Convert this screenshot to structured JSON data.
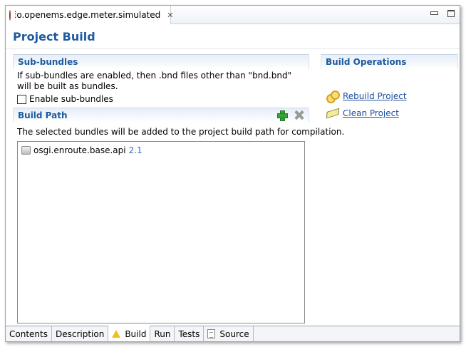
{
  "editor_tab": {
    "title": "io.openems.edge.meter.simulated",
    "close": "✕"
  },
  "form": {
    "title": "Project Build"
  },
  "sub_bundles": {
    "header": "Sub-bundles",
    "description": "If sub-bundles are enabled, then .bnd files other than \"bnd.bnd\" will be built as bundles.",
    "checkbox_label": "Enable sub-bundles",
    "checked": false
  },
  "build_path": {
    "header": "Build Path",
    "description": "The selected bundles will be added to the project build path for compilation.",
    "items": [
      {
        "name": "osgi.enroute.base.api",
        "version": "2.1"
      }
    ]
  },
  "build_operations": {
    "header": "Build Operations",
    "rebuild_label": "Rebuild Project",
    "clean_label": "Clean Project"
  },
  "bottom_tabs": [
    "Contents",
    "Description",
    "Build",
    "Run",
    "Tests",
    "Source"
  ],
  "active_tab": "Build",
  "colors": {
    "accent": "#1d5a9e",
    "link": "#1d4fa0",
    "version": "#2d6fbd"
  }
}
